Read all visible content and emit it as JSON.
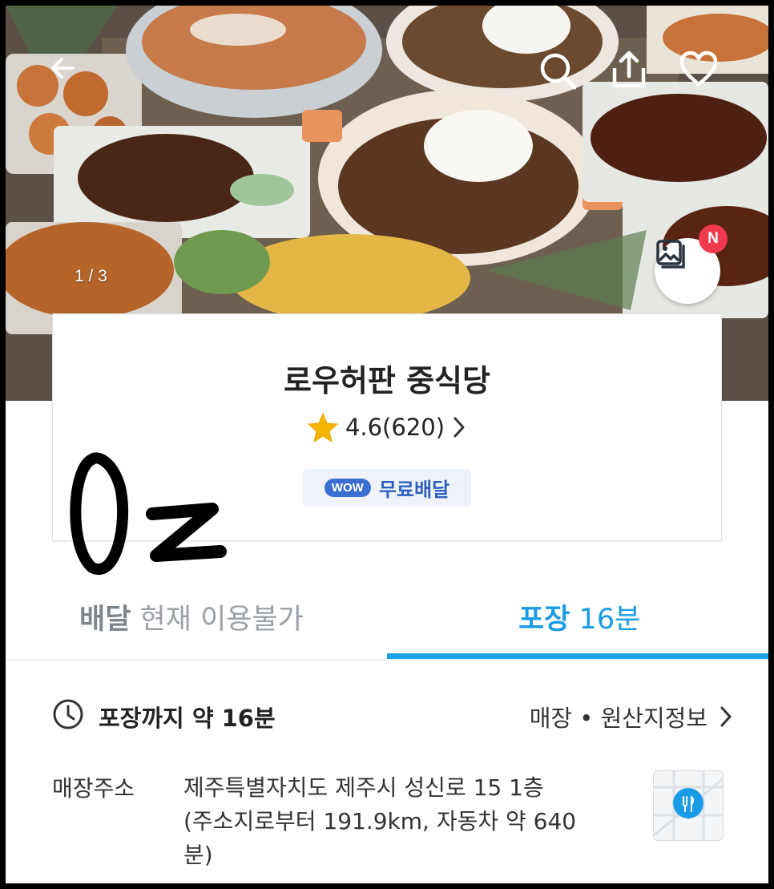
{
  "hero": {
    "page_counter": "1 / 3",
    "photo_badge": "N"
  },
  "store": {
    "name": "로우허판 중식당",
    "rating": "4.6(620)",
    "wow_badge": "WOW",
    "free_delivery": "무료배달"
  },
  "tabs": {
    "delivery_label": "배달",
    "delivery_status": "현재 이용불가",
    "pickup_label": "포장",
    "pickup_time": "16분",
    "active": "pickup"
  },
  "pickup": {
    "time_text": "포장까지 약 16분",
    "store_info_link": "매장 • 원산지정보"
  },
  "address": {
    "label": "매장주소",
    "line1": "제주특별자치도 제주시 성신로 15 1층",
    "line2": "(주소지로부터 191.9km, 자동차 약 640",
    "line3": "분)"
  },
  "colors": {
    "accent_blue": "#1aa3e8",
    "wow_blue": "#3a6fd1",
    "badge_red": "#ef3b4d",
    "star_yellow": "#f7b500"
  }
}
